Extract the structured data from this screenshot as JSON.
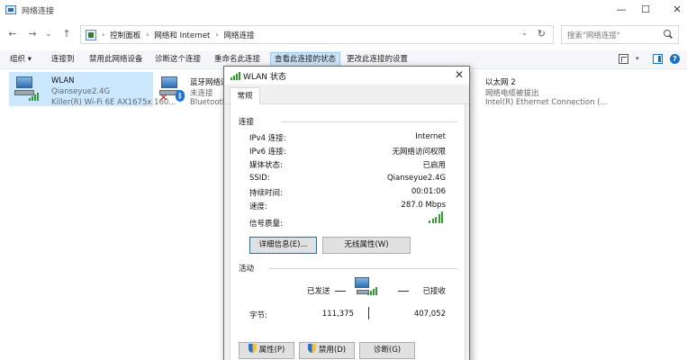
{
  "window": {
    "title": "网络连接",
    "controls": [
      "—",
      "☐",
      "✕"
    ]
  },
  "nav": {
    "back": "←",
    "forward": "→",
    "recent": "⌄",
    "up": "↑",
    "breadcrumb": [
      "控制面板",
      "网络和 Internet",
      "网络连接"
    ],
    "separator": "›",
    "search_placeholder": "搜索\"网络连接\""
  },
  "toolbar": {
    "organize": "组织 ▾",
    "items": [
      "连接到",
      "禁用此网络设备",
      "诊断这个连接",
      "重命名此连接",
      "查看此连接的状态",
      "更改此连接的设置"
    ],
    "active_item": "查看此连接的状态"
  },
  "connections": [
    {
      "name": "WLAN",
      "status": "Qianseyue2.4G",
      "device": "Killer(R) Wi-Fi 6E AX1675x 160...",
      "selected": true
    },
    {
      "name": "蓝牙网络连接",
      "status": "未连接",
      "device": "Bluetooth",
      "selected": false
    },
    {
      "name": "以太网 2",
      "status": "网络电缆被拔出",
      "device": "Intel(R) Ethernet Connection (...",
      "selected": false
    }
  ],
  "dialog": {
    "title": "WLAN 状态",
    "close": "✕",
    "tab": "常规",
    "connection_group": "连接",
    "rows": [
      {
        "label": "IPv4 连接:",
        "value": "Internet"
      },
      {
        "label": "IPv6 连接:",
        "value": "无网络访问权限"
      },
      {
        "label": "媒体状态:",
        "value": "已启用"
      },
      {
        "label": "SSID:",
        "value": "Qianseyue2.4G"
      },
      {
        "label": "持续时间:",
        "value": "00:01:06"
      },
      {
        "label": "速度:",
        "value": "287.0 Mbps"
      },
      {
        "label": "信号质量:",
        "value": ""
      }
    ],
    "signal_level": 1.0,
    "details_button": "详细信息(E)...",
    "wireless_button": "无线属性(W)",
    "activity_group": "活动",
    "sent_label": "已发送",
    "received_label": "已接收",
    "bytes_label": "字节:",
    "bytes_sent": "111,375",
    "bytes_received": "407,052",
    "properties_button": "属性(P)",
    "disable_button": "禁用(D)",
    "diagnose_button": "诊断(G)"
  }
}
